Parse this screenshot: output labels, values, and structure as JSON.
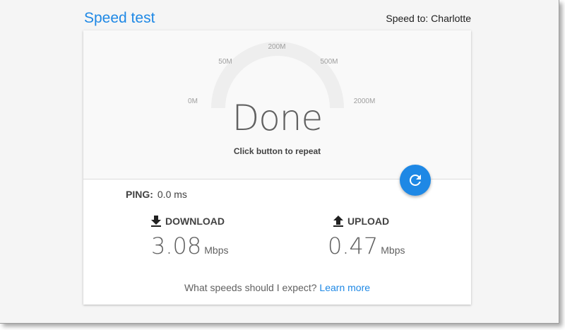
{
  "header": {
    "title": "Speed test",
    "server_label": "Speed to: Charlotte"
  },
  "gauge": {
    "ticks": [
      "0M",
      "50M",
      "200M",
      "500M",
      "2000M"
    ],
    "status": "Done",
    "hint": "Click button to repeat",
    "repeat_icon": "refresh-icon"
  },
  "ping": {
    "label": "PING:",
    "value": "0.0 ms"
  },
  "download": {
    "label": "DOWNLOAD",
    "value": "3.08",
    "unit": "Mbps",
    "icon": "download-icon"
  },
  "upload": {
    "label": "UPLOAD",
    "value": "0.47",
    "unit": "Mbps",
    "icon": "upload-icon"
  },
  "footer": {
    "question": "What speeds should I expect?",
    "link": "Learn more"
  },
  "colors": {
    "accent": "#1e88e5",
    "gauge_track": "#eeeeee"
  }
}
